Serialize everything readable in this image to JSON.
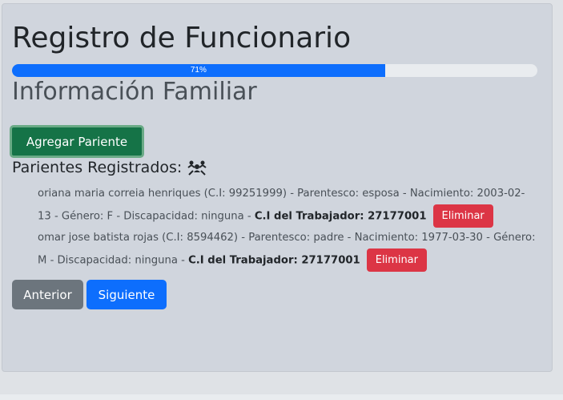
{
  "page": {
    "title": "Registro de Funcionario",
    "section_title": "Información Familiar"
  },
  "progress": {
    "value": 71,
    "label": "71%",
    "color": "#0d6efd"
  },
  "buttons": {
    "add_label": "Agregar Pariente",
    "prev_label": "Anterior",
    "next_label": "Siguiente"
  },
  "parientes": {
    "heading": "Parientes Registrados:",
    "icon": "family-icon",
    "items": [
      {
        "details": "oriana maria correia henriques (C.I: 99251999) - Parentesco: esposa - Nacimiento: 2003-02-13 - Género: F - Discapacidad: ninguna - ",
        "worker": "C.I del Trabajador: 27177001",
        "delete_label": "Eliminar"
      },
      {
        "details": "omar jose batista rojas (C.I: 8594462) - Parentesco: padre - Nacimiento: 1977-03-30 - Género: M - Discapacidad: ninguna - ",
        "worker": "C.I del Trabajador: 27177001",
        "delete_label": "Eliminar"
      }
    ]
  },
  "colors": {
    "success": "#157347",
    "danger": "#dc3545",
    "secondary": "#6c757d",
    "primary": "#0d6efd"
  }
}
